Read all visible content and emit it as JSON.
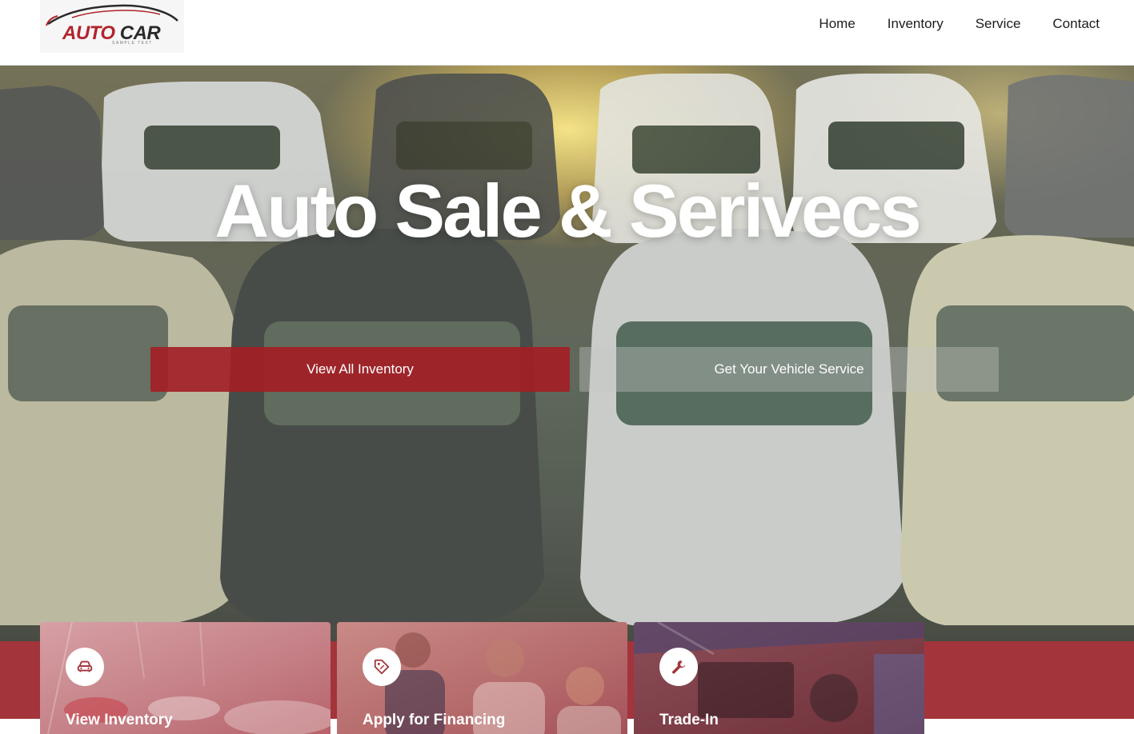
{
  "header": {
    "logo": {
      "brand_primary": "AUTO",
      "brand_secondary": "CAR",
      "tagline": "SAMPLE TEXT"
    },
    "nav": [
      {
        "label": "Home"
      },
      {
        "label": "Inventory"
      },
      {
        "label": "Service"
      },
      {
        "label": "Contact"
      }
    ]
  },
  "hero": {
    "title": "Auto Sale & Serivecs",
    "primary_button": "View All Inventory",
    "secondary_button": "Get Your Vehicle Service"
  },
  "cards": [
    {
      "icon": "car-icon",
      "title": "View Inventory"
    },
    {
      "icon": "tag-icon",
      "title": "Apply for Financing"
    },
    {
      "icon": "wrench-icon",
      "title": "Trade-In"
    }
  ],
  "colors": {
    "accent": "#a3343b",
    "button_primary": "#a32026",
    "text_dark": "#1c1c1c",
    "white": "#ffffff"
  }
}
